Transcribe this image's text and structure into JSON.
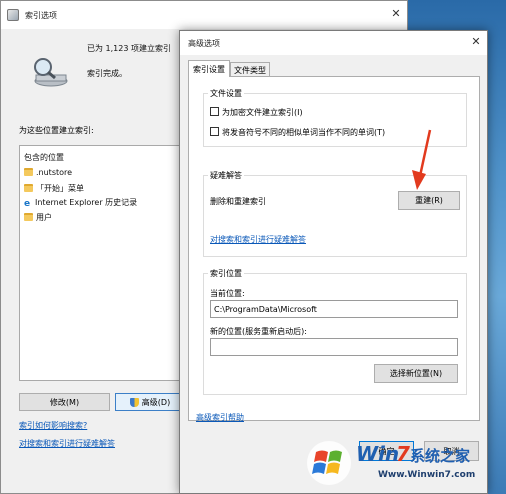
{
  "back_window": {
    "title": "索引选项",
    "indexed_count_text": "已为 1,123 项建立索引",
    "status_text": "索引完成。",
    "section_label": "为这些位置建立索引:",
    "list_header": "包含的位置",
    "locations": [
      {
        "label": ".nutstore",
        "icon": "folder-icon"
      },
      {
        "label": "「开始」菜单",
        "icon": "folder-icon"
      },
      {
        "label": "Internet Explorer 历史记录",
        "icon": "ie-icon"
      },
      {
        "label": "用户",
        "icon": "folder-icon"
      }
    ],
    "modify_button": "修改(M)",
    "advanced_button": "高级(D)",
    "link_how_affects": "索引如何影响搜索?",
    "link_troubleshoot": "对搜索和索引进行疑难解答",
    "close_glyph": "✕"
  },
  "dialog": {
    "title": "高级选项",
    "close_glyph": "✕",
    "tabs": [
      {
        "label": "索引设置",
        "active": true
      },
      {
        "label": "文件类型",
        "active": false
      }
    ],
    "file_settings": {
      "title": "文件设置",
      "checkbox_encrypted": "为加密文件建立索引(I)",
      "checkbox_diacritics": "将发音符号不同的相似单词当作不同的单词(T)",
      "encrypted_checked": false,
      "diacritics_checked": false
    },
    "troubleshooting": {
      "title": "疑难解答",
      "rebuild_label": "删除和重建索引",
      "rebuild_button": "重建(R)",
      "link": "对搜索和索引进行疑难解答"
    },
    "index_location": {
      "title": "索引位置",
      "current_label": "当前位置:",
      "current_value": "C:\\ProgramData\\Microsoft",
      "new_label": "新的位置(服务重新启动后):",
      "new_value": "",
      "select_button": "选择新位置(N)"
    },
    "help_link": "高级索引帮助",
    "ok_button": "确定",
    "cancel_button": "取消"
  },
  "watermark": {
    "brand_win": "Win",
    "brand_seven": "7",
    "brand_cn": "系统之家",
    "url": "Www.Winwin7.com"
  },
  "colors": {
    "link": "#0a58b8",
    "arrow": "#e23a1e",
    "watermark_blue": "#1f5fb0",
    "watermark_red": "#e23a1e"
  }
}
